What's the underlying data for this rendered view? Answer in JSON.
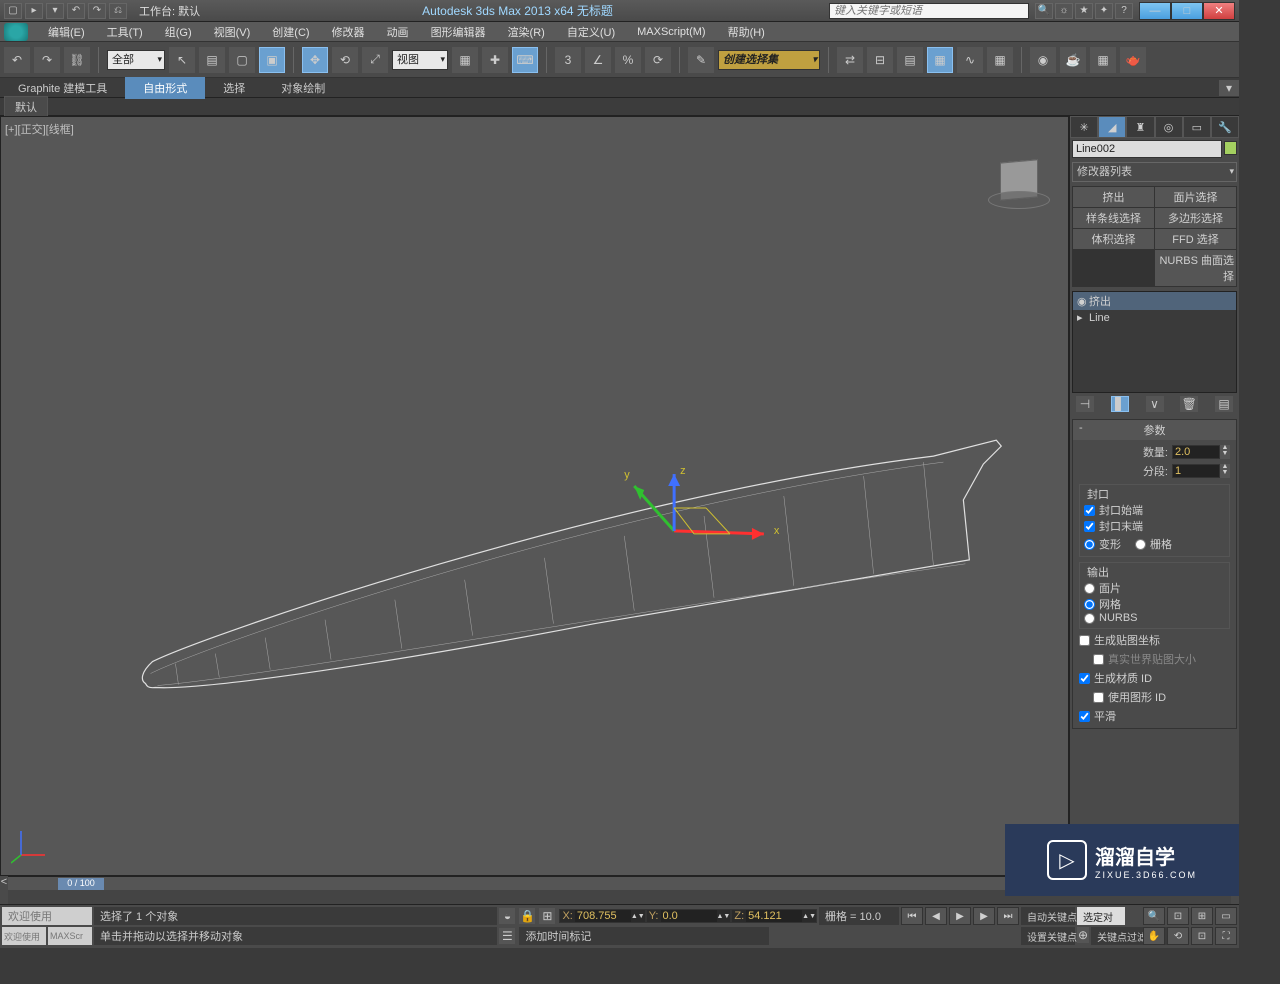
{
  "titlebar": {
    "workspace_label": "工作台: 默认",
    "app_title": "Autodesk 3ds Max 2013 x64    无标题",
    "search_placeholder": "键入关键字或短语"
  },
  "menu": {
    "items": [
      "编辑(E)",
      "工具(T)",
      "组(G)",
      "视图(V)",
      "创建(C)",
      "修改器",
      "动画",
      "图形编辑器",
      "渲染(R)",
      "自定义(U)",
      "MAXScript(M)",
      "帮助(H)"
    ]
  },
  "toolbar": {
    "filter": "全部",
    "refsys": "视图",
    "named_sel": "创建选择集"
  },
  "ribbon": {
    "tabs": [
      "Graphite 建模工具",
      "自由形式",
      "选择",
      "对象绘制"
    ],
    "active": 1,
    "sub": "默认"
  },
  "viewport": {
    "label": "[+][正交][线框]",
    "axes": {
      "x": "x",
      "y": "y",
      "z": "z"
    }
  },
  "panel": {
    "object": "Line002",
    "modlist_label": "修改器列表",
    "mod_buttons": [
      "挤出",
      "面片选择",
      "样条线选择",
      "多边形选择",
      "体积选择",
      "FFD 选择",
      "NURBS 曲面选择"
    ],
    "stack": [
      "挤出",
      "Line"
    ],
    "rollout_params": "参数",
    "amount_label": "数量:",
    "amount": "2.0",
    "segments_label": "分段:",
    "segments": "1",
    "cap_group": "封口",
    "cap_start": "封口始端",
    "cap_end": "封口末端",
    "cap_morph": "变形",
    "cap_grid": "栅格",
    "output_group": "输出",
    "out_patch": "面片",
    "out_mesh": "网格",
    "out_nurbs": "NURBS",
    "gen_map": "生成贴图坐标",
    "real_world": "真实世界贴图大小",
    "gen_mat": "生成材质 ID",
    "use_shape": "使用图形 ID",
    "smooth": "平滑"
  },
  "timeline": {
    "pos": "0 / 100"
  },
  "status": {
    "sel": "选择了 1 个对象",
    "hint": "单击并拖动以选择并移动对象",
    "x": "708.755",
    "y": "0.0",
    "z": "54.121",
    "grid": "栅格 = 10.0",
    "autokey": "自动关键点",
    "selopt": "选定对",
    "setkey": "设置关键点",
    "keyfilter": "关键点过滤器...",
    "addtag": "添加时间标记",
    "welcome": "欢迎使用",
    "maxscript": "MAXScr"
  },
  "watermark": {
    "title": "溜溜自学",
    "url": "ZIXUE.3D66.COM"
  }
}
